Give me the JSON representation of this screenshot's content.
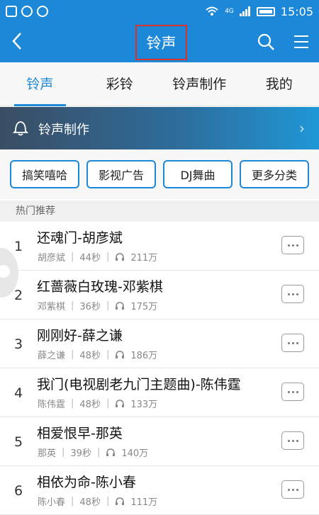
{
  "statusbar": {
    "time": "15:05",
    "network": "4G"
  },
  "appbar": {
    "title": "铃声"
  },
  "tabs": [
    {
      "label": "铃声",
      "active": true
    },
    {
      "label": "彩铃",
      "active": false
    },
    {
      "label": "铃声制作",
      "active": false
    },
    {
      "label": "我的",
      "active": false
    }
  ],
  "banner": {
    "label": "铃声制作"
  },
  "categories": [
    "搞笑嘻哈",
    "影视广告",
    "DJ舞曲",
    "更多分类"
  ],
  "section": {
    "title": "热门推荐"
  },
  "songs": [
    {
      "index": "1",
      "title": "还魂门-胡彦斌",
      "artist": "胡彦斌",
      "duration": "44秒",
      "plays": "211万"
    },
    {
      "index": "2",
      "title": "红蔷薇白玫瑰-邓紫棋",
      "artist": "邓紫棋",
      "duration": "36秒",
      "plays": "175万"
    },
    {
      "index": "3",
      "title": "刚刚好-薛之谦",
      "artist": "薛之谦",
      "duration": "48秒",
      "plays": "186万"
    },
    {
      "index": "4",
      "title": "我门(电视剧老九门主题曲)-陈伟霆",
      "artist": "陈伟霆",
      "duration": "48秒",
      "plays": "133万"
    },
    {
      "index": "5",
      "title": "相爱恨早-那英",
      "artist": "那英",
      "duration": "39秒",
      "plays": "140万"
    },
    {
      "index": "6",
      "title": "相依为命-陈小春",
      "artist": "陈小春",
      "duration": "48秒",
      "plays": "111万"
    }
  ],
  "colors": {
    "primary": "#1e88d8",
    "highlight_box": "#d9332b"
  }
}
